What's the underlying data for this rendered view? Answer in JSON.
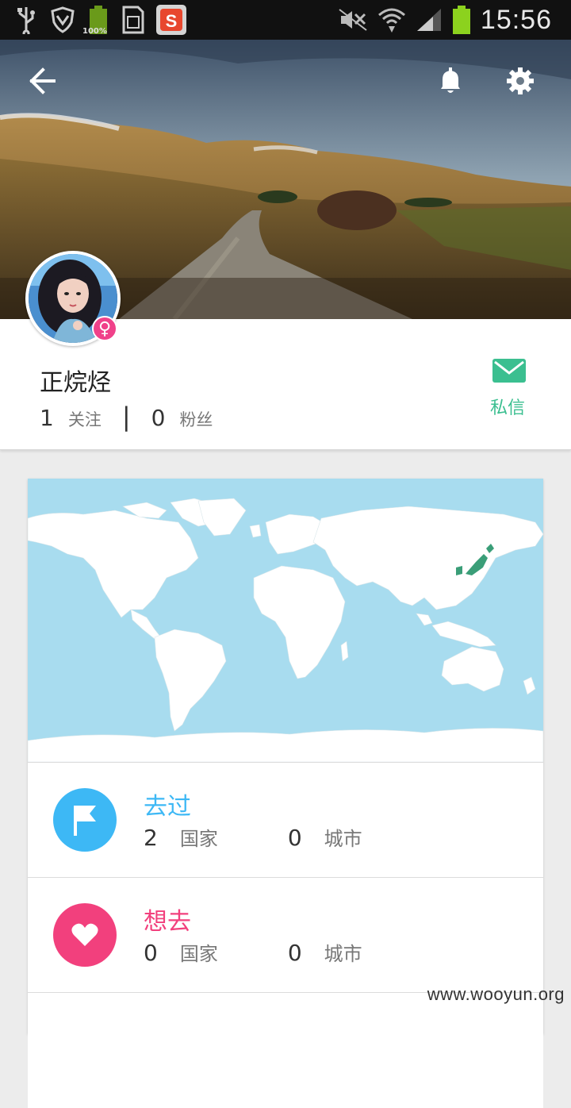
{
  "status_bar": {
    "battery_left_label": "100%",
    "sim_label": "S",
    "time": "15:56"
  },
  "profile": {
    "name": "正烷烃",
    "following_count": "1",
    "following_label": "关注",
    "separator": "|",
    "followers_count": "0",
    "followers_label": "粉丝",
    "gender_symbol": "♀",
    "message_label": "私信"
  },
  "visited": {
    "title": "去过",
    "countries_count": "2",
    "countries_label": "国家",
    "cities_count": "0",
    "cities_label": "城市",
    "color": "#3db8f5"
  },
  "wish": {
    "title": "想去",
    "countries_count": "0",
    "countries_label": "国家",
    "cities_count": "0",
    "cities_label": "城市",
    "color": "#f2407d"
  },
  "colors": {
    "accent_green": "#3bbf90",
    "map_ocean": "#a8dcef",
    "map_land": "#ffffff",
    "map_highlight": "#3a9e78"
  },
  "watermark": "www.wooyun.org"
}
